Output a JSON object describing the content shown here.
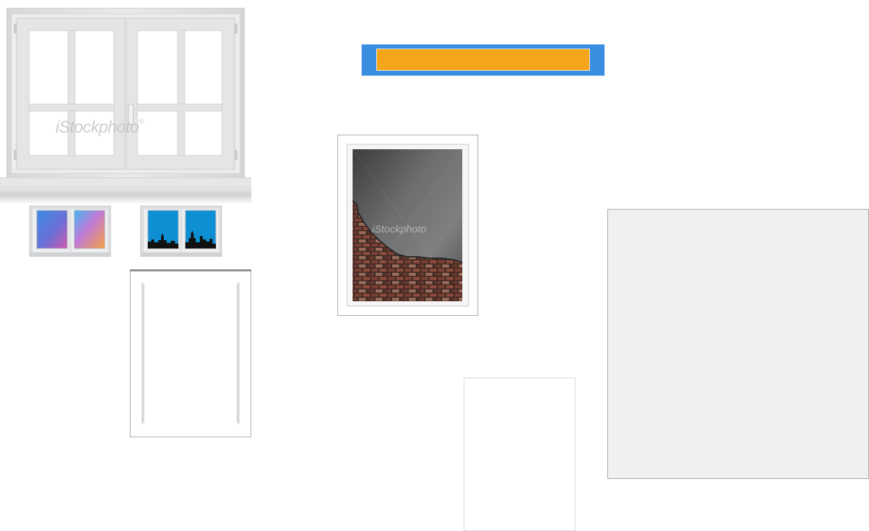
{
  "watermark": {
    "text": "iStockphoto",
    "registered": "®"
  },
  "icons": {
    "large_window": "double-casement-window-icon",
    "small_window_gradient": "small-window-gradient-icon",
    "small_window_skyline": "small-window-skyline-icon",
    "door_panel": "door-panel-icon",
    "brick_frame": "framed-brick-wall-icon",
    "blank_frame": "blank-frame-icon",
    "gray_panel": "gray-panel-icon"
  },
  "colors": {
    "banner_outer": "#3a8ee0",
    "banner_inner": "#f5a519",
    "gray_panel_fill": "#f0f0f0",
    "sky_blue": "#0e8fd4"
  }
}
